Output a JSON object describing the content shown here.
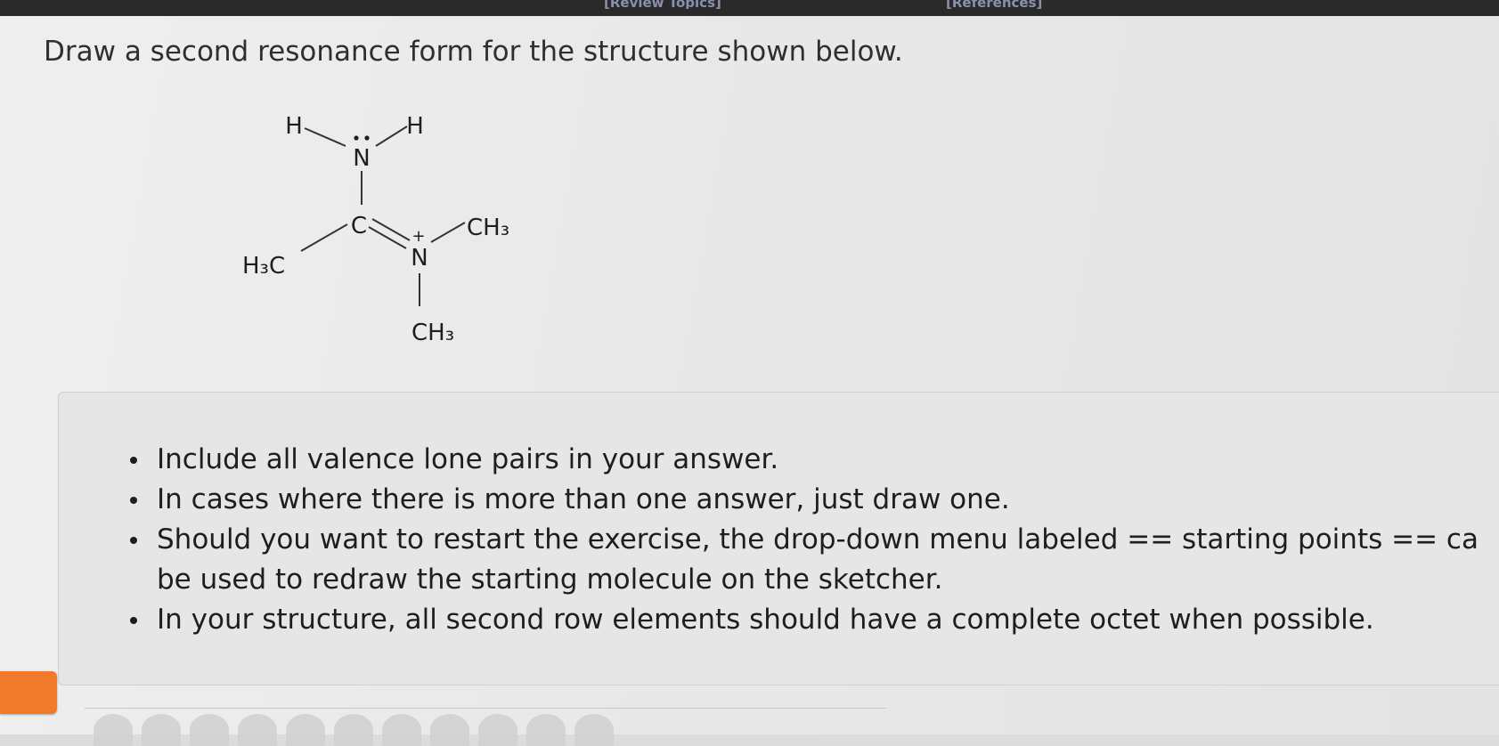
{
  "top_links": [
    "[Review Topics]",
    "[References]"
  ],
  "question": "Draw a second resonance form for the structure shown below.",
  "molecule": {
    "atoms": {
      "h_left": "H",
      "h_right": "H",
      "n_top": "N",
      "c_center": "C",
      "n_plus": "N",
      "plus_charge": "+",
      "ch3_left": "H₃C",
      "ch3_right": "CH₃",
      "ch3_bottom": "CH₃"
    }
  },
  "instructions": [
    "Include all valence lone pairs in your answer.",
    "In cases where there is more than one answer, just draw one.",
    "Should you want to restart the exercise, the drop-down menu labeled == starting points == ca",
    "be used to redraw the starting molecule on the sketcher.",
    "In your structure, all second row elements should have a complete octet when possible."
  ],
  "toolbar": {
    "tools": [
      "eraser-icon",
      "lasso-icon",
      "pencil-icon",
      "ring-icon",
      "template-icon",
      "charge-icon",
      "shape-icon",
      "text-icon",
      "plus-icon",
      "minus-icon",
      "element-icon"
    ]
  },
  "colors": {
    "accent_tab": "#f07a2a",
    "text": "#2f2f2f"
  }
}
